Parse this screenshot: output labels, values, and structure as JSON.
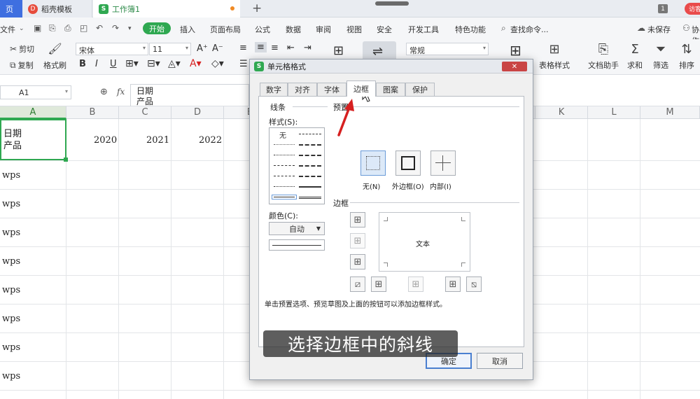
{
  "tabs": {
    "home": "页",
    "template": "稻壳模板",
    "workbook": "工作簿1",
    "new_tab": "+",
    "window_count": "1",
    "user": "访客"
  },
  "menu": {
    "file": "文件",
    "start": "开始",
    "items": [
      "插入",
      "页面布局",
      "公式",
      "数据",
      "审阅",
      "视图",
      "安全",
      "开发工具",
      "特色功能"
    ],
    "search": "查找命令...",
    "unsaved": "未保存",
    "cooperate": "协作"
  },
  "ribbon": {
    "cut": "剪切",
    "copy": "复制",
    "format_painter": "格式刷",
    "font_name": "宋体",
    "font_size": "11",
    "number_format": "常规",
    "table_style": "表格样式",
    "doc_helper": "文档助手",
    "sum": "求和",
    "filter": "筛选",
    "sort": "排序"
  },
  "formula_bar": {
    "name_box": "A1",
    "fx": "fx",
    "content_line1": "日期",
    "content_line2": "产品"
  },
  "sheet": {
    "columns": [
      "A",
      "B",
      "C",
      "D",
      "E",
      "K",
      "L",
      "M"
    ],
    "a1_line1": "日期",
    "a1_line2": "产品",
    "years": [
      "2020",
      "2021",
      "2022"
    ],
    "rows": [
      "wps",
      "wps",
      "wps",
      "wps",
      "wps",
      "wps",
      "wps",
      "wps"
    ]
  },
  "dialog": {
    "title": "单元格格式",
    "tabs": [
      "数字",
      "对齐",
      "字体",
      "边框",
      "图案",
      "保护"
    ],
    "active_tab": "边框",
    "line_group": "线条",
    "style_label": "样式(S):",
    "style_none": "无",
    "color_label": "颜色(C):",
    "color_value": "自动",
    "preset_group": "预置",
    "preset_none": "无(N)",
    "preset_outline": "外边框(O)",
    "preset_inside": "内部(I)",
    "border_group": "边框",
    "preview_text": "文本",
    "hint": "单击预置选项、预览草图及上面的按钮可以添加边框样式。",
    "ok": "确定",
    "cancel": "取消"
  },
  "caption": "选择边框中的斜线",
  "colors": {
    "accent_green": "#2fa851",
    "tab_blue": "#3f6fe0",
    "arrow_red": "#d62020"
  }
}
